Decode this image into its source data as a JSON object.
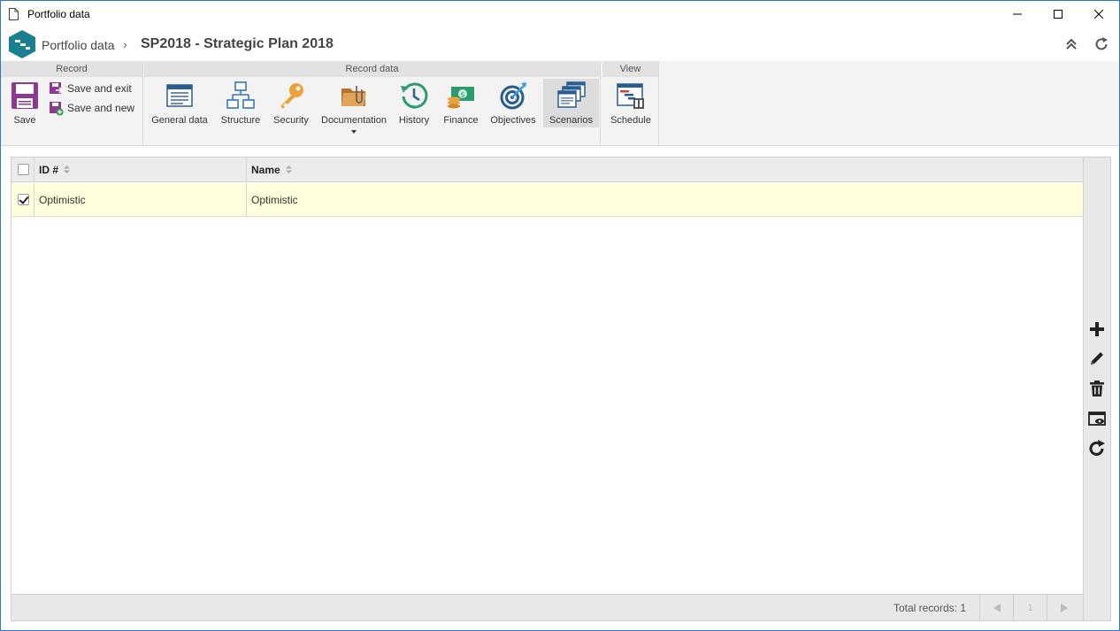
{
  "window": {
    "title": "Portfolio data"
  },
  "breadcrumb": {
    "root": "Portfolio data",
    "separator": "›",
    "current": "SP2018 - Strategic Plan 2018"
  },
  "ribbon": {
    "groups": {
      "record": "Record",
      "record_data": "Record data",
      "view": "View"
    },
    "buttons": {
      "save": "Save",
      "save_and_exit": "Save and exit",
      "save_and_new": "Save and new",
      "general_data": "General data",
      "structure": "Structure",
      "security": "Security",
      "documentation": "Documentation",
      "history": "History",
      "finance": "Finance",
      "objectives": "Objectives",
      "scenarios": "Scenarios",
      "schedule": "Schedule"
    }
  },
  "grid": {
    "columns": {
      "id": "ID #",
      "name": "Name"
    },
    "rows": [
      {
        "id": "Optimistic",
        "name": "Optimistic",
        "checked": true
      }
    ],
    "footer": {
      "total_records": "Total records: 1",
      "page": "1"
    }
  },
  "colors": {
    "accent_teal": "#1a7f8e",
    "row_highlight": "#ffffdd",
    "save_purple": "#8b3a8f"
  }
}
